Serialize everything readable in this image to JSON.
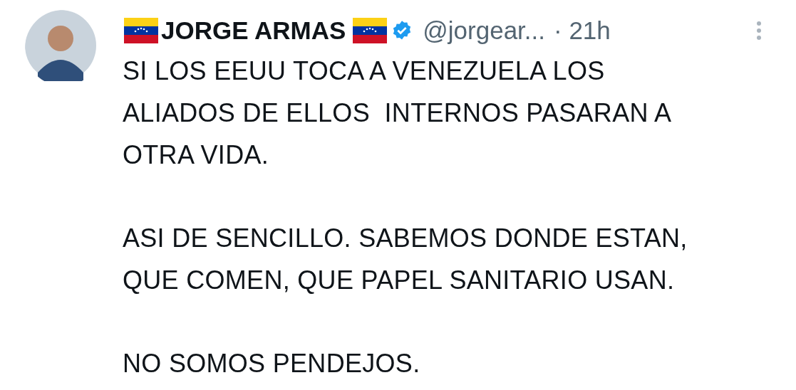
{
  "tweet": {
    "author": {
      "name": "JORGE ARMAS",
      "verified": true,
      "handle": "@jorgear...",
      "time": "· 21h"
    },
    "paragraphs": [
      {
        "lines": [
          "SI LOS EEUU TOCA A VENEZUELA LOS",
          "ALIADOS DE ELLOS  INTERNOS PASARAN A",
          "OTRA VIDA."
        ]
      },
      {
        "lines": [
          "ASI DE SENCILLO. SABEMOS DONDE ESTAN,",
          "QUE COMEN, QUE PAPEL SANITARIO USAN."
        ]
      },
      {
        "lines": [
          "NO SOMOS PENDEJOS."
        ]
      }
    ]
  }
}
